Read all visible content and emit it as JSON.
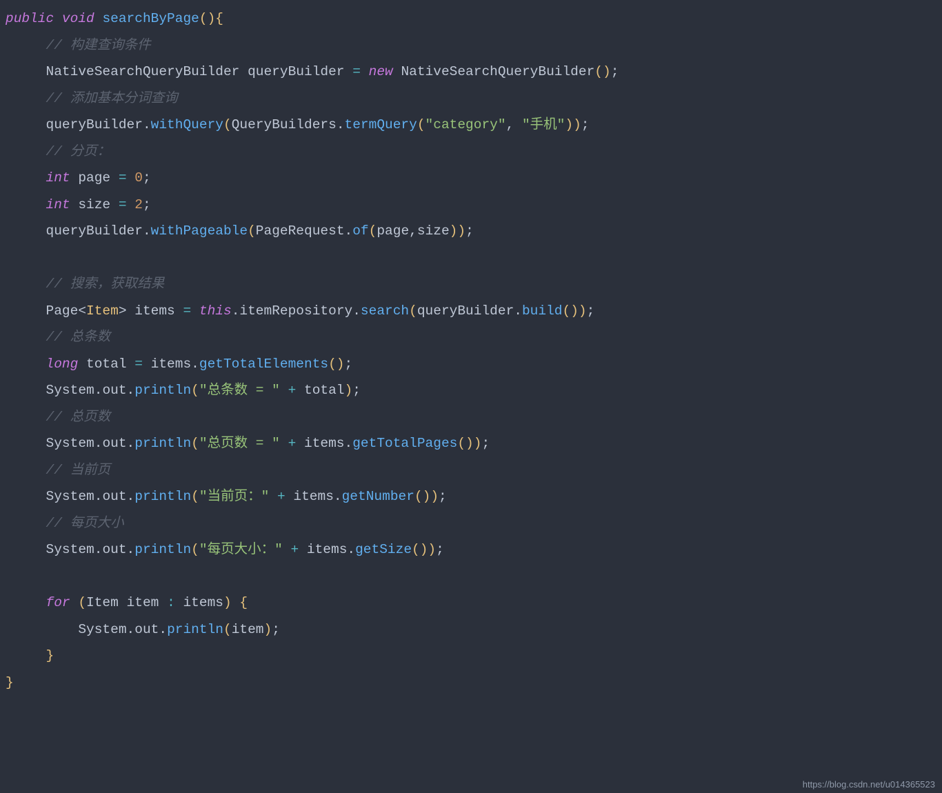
{
  "watermark": "https://blog.csdn.net/u014365523",
  "code": {
    "kw_public": "public",
    "kw_void": "void",
    "fn_searchByPage": "searchByPage",
    "cmt_build": "// 构建查询条件",
    "id_NSQB": "NativeSearchQueryBuilder",
    "id_queryBuilder": "queryBuilder",
    "kw_new": "new",
    "cmt_tokenize": "// 添加基本分词查询",
    "m_withQuery": "withQuery",
    "id_QueryBuilders": "QueryBuilders",
    "m_termQuery": "termQuery",
    "str_category": "\"category\"",
    "str_phone": "\"手机\"",
    "cmt_paging": "// 分页：",
    "kw_int1": "int",
    "id_page": "page",
    "num_0": "0",
    "kw_int2": "int",
    "id_size": "size",
    "num_2": "2",
    "m_withPageable": "withPageable",
    "id_PageRequest": "PageRequest",
    "m_of": "of",
    "cmt_search": "// 搜索，获取结果",
    "id_Page": "Page",
    "type_Item": "Item",
    "id_items": "items",
    "kw_this": "this",
    "id_itemRepository": "itemRepository",
    "m_search": "search",
    "m_build": "build",
    "cmt_totalcount": "// 总条数",
    "kw_long": "long",
    "id_total": "total",
    "m_getTotalElements": "getTotalElements",
    "id_System": "System",
    "id_out": "out",
    "m_println": "println",
    "str_totalcount": "\"总条数 = \"",
    "cmt_totalpages": "// 总页数",
    "str_totalpages": "\"总页数 = \"",
    "m_getTotalPages": "getTotalPages",
    "cmt_currentpage": "// 当前页",
    "str_currentpage": "\"当前页：\"",
    "m_getNumber": "getNumber",
    "cmt_pagesize": "// 每页大小",
    "str_pagesize": "\"每页大小：\"",
    "m_getSize": "getSize",
    "kw_for": "for",
    "id_Item2": "Item",
    "id_item": "item"
  }
}
